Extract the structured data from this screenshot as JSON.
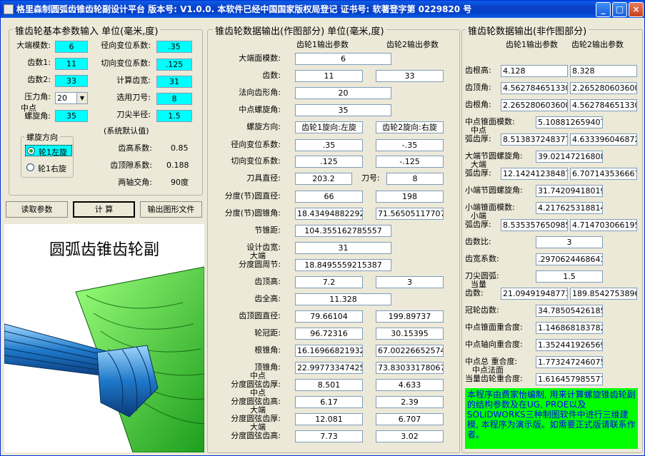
{
  "window": {
    "title": "格里森制圆弧齿锥齿轮副设计平台  版本号: V1.0.0.   本软件已经中国国家版权局登记   证书号: 软著登字第 0229820 号",
    "min_label": "_",
    "max_label": "□",
    "close_label": "×"
  },
  "left": {
    "legend": "锥齿轮基本参数输入  单位(毫米,度)",
    "module_label": "大端模数:",
    "module_value": "6",
    "teeth1_label": "齿数1:",
    "teeth1_value": "11",
    "teeth2_label": "齿数2:",
    "teeth2_value": "33",
    "pressure_label": "压力角:",
    "pressure_value": "20",
    "spiral_label_1": "中点",
    "spiral_label_2": "螺旋角:",
    "spiral_value": "35",
    "radial_shift_label": "径向变位系数:",
    "radial_shift_value": ".35",
    "tangential_shift_label": "切向变位系数:",
    "tangential_shift_value": ".125",
    "face_width_label": "计算齿宽:",
    "face_width_value": "31",
    "cutter_no_label": "选用刀号:",
    "cutter_no_value": "8",
    "tip_radius_label": "刀尖半径:",
    "tip_radius_value": "1.5",
    "spiral_dir_legend": "螺旋方向",
    "left_hand_label": "轮1左旋",
    "right_hand_label": "轮1右旋",
    "defaults_title": "(系统默认值)",
    "addendum_coef_label": "齿高系数:",
    "addendum_coef_value": "0.85",
    "clearance_coef_label": "齿顶隙系数:",
    "clearance_coef_value": "0.188",
    "shaft_angle_label": "两轴交角:",
    "shaft_angle_value": "90度",
    "read_button": "读取参数",
    "calc_button": "计  算",
    "export_button": "输出图形文件",
    "picture_title": "圆弧齿锥齿轮副"
  },
  "middle": {
    "legend": "锥齿轮数据输出(作图部分) 单位(毫米,度)",
    "col1_header": "齿轮1输出参数",
    "col2_header": "齿轮2输出参数",
    "rows": [
      {
        "label": "大端面模数:",
        "v1": "6"
      },
      {
        "label": "齿数:",
        "v1": "11",
        "v2": "33"
      },
      {
        "label": "法向齿形角:",
        "v1": "20"
      },
      {
        "label": "中点螺旋角:",
        "v1": "35"
      },
      {
        "label": "螺旋方向:",
        "v1": "齿轮1旋向:左旋",
        "v2": "齿轮2旋向:右旋"
      },
      {
        "label": "径向变位系数:",
        "v1": ".35",
        "v2": "-.35"
      },
      {
        "label": "切向变位系数:",
        "v1": ".125",
        "v2": "-.125"
      },
      {
        "label": "刀具直径:",
        "v1": "203.2",
        "mid": "刀号:",
        "v2": "8"
      },
      {
        "label": "分度(节)圆直径:",
        "v1": "66",
        "v2": "198"
      },
      {
        "label": "分度(节)圆锥角:",
        "v1": "18.434948822922",
        "v2": "71.565051177078"
      },
      {
        "label": "节锥距:",
        "v1": "104.355162785557"
      },
      {
        "label": "设计齿宽:",
        "v1": "31"
      },
      {
        "label": "分度圆周节:",
        "pre": "大端",
        "v1": "18.8495559215387"
      },
      {
        "label": "齿顶高:",
        "v1": "7.2",
        "v2": "3"
      },
      {
        "label": "齿全高:",
        "v1": "11.328"
      },
      {
        "label": "齿顶圆直径:",
        "v1": "79.66104",
        "v2": "199.89737"
      },
      {
        "label": "轮冠距:",
        "v1": "96.72316",
        "v2": "30.15395"
      },
      {
        "label": "根锥角:",
        "v1": "16.16966821932",
        "v2": "67.002266525748"
      },
      {
        "label": "顶锥角:",
        "v1": "22.997733474252",
        "v2": "73.830331780678"
      },
      {
        "label": "分度圆弦齿厚:",
        "pre": "中点",
        "v1": "8.501",
        "v2": "4.633"
      },
      {
        "label": "分度圆弦齿高:",
        "pre": "中点",
        "v1": "6.17",
        "v2": "2.39"
      },
      {
        "label": "分度圆弦齿厚:",
        "pre": "大端",
        "v1": "12.081",
        "v2": "6.707"
      },
      {
        "label": "分度圆弦齿高:",
        "pre": "大端",
        "v1": "7.73",
        "v2": "3.02"
      }
    ]
  },
  "right": {
    "legend": "锥齿轮数据输出(非作图部分)",
    "col1_header": "齿轮1输出参数",
    "col2_header": "齿轮2输出参数",
    "rows": [
      {
        "label": "齿根高:",
        "v1": "4.128",
        "v2": "8.328"
      },
      {
        "label": "齿顶角:",
        "v1": "4.5627846513300",
        "v2": "2.2652806036003"
      },
      {
        "label": "齿根角:",
        "v1": "2.2652806036003",
        "v2": "4.5627846513300"
      },
      {
        "label": "中点锥面模数:",
        "v1": "5.1088126594070"
      },
      {
        "label": "弧齿厚:",
        "pre": "中点",
        "v1": "8.5138372483775",
        "v2": "4.6333960468725"
      },
      {
        "label": "大端节圆螺旋角:",
        "v1": "39.021472168088"
      },
      {
        "label": "弧齿厚:",
        "pre": "大端",
        "v1": "12.14241238487",
        "v2": "6.7071435366677"
      },
      {
        "label": "小端节圆螺旋角:",
        "v1": "31.742094180192"
      },
      {
        "label": "小端锥面模数:",
        "v1": "4.2176253188141"
      },
      {
        "label": "弧齿厚:",
        "pre": "小端",
        "v1": "8.5353576509858",
        "v2": "4.7147030661951"
      },
      {
        "label": "齿数比:",
        "v1": "3"
      },
      {
        "label": "齿宽系数:",
        "v1": ".29706244686430"
      },
      {
        "label": "刀尖圆弧:",
        "v1": "1.5"
      },
      {
        "label": "齿数:",
        "pre": "当量",
        "v1": "21.094919487733",
        "v2": "189.85427538960"
      },
      {
        "label": "冠轮齿数:",
        "v1": "34.785054261852"
      },
      {
        "label": "中点锥面重合度:",
        "v1": "1.1468681837825"
      },
      {
        "label": "中点轴向重合度:",
        "v1": "1.3524419265691"
      },
      {
        "label": "中点总  重合度:",
        "v1": "1.7732472460756"
      },
      {
        "label": "当量齿轮重合度:",
        "pre": "中点法面",
        "v1": "1.6164579855778"
      }
    ],
    "note": "本程序由费家怡编制, 用来计算螺旋锥齿轮副的结构参数及在UG, PROE以及SOLIDWORKS三种制图软件中进行三维建模, 本程序为演示版。如需要正式版请联系作者。"
  }
}
